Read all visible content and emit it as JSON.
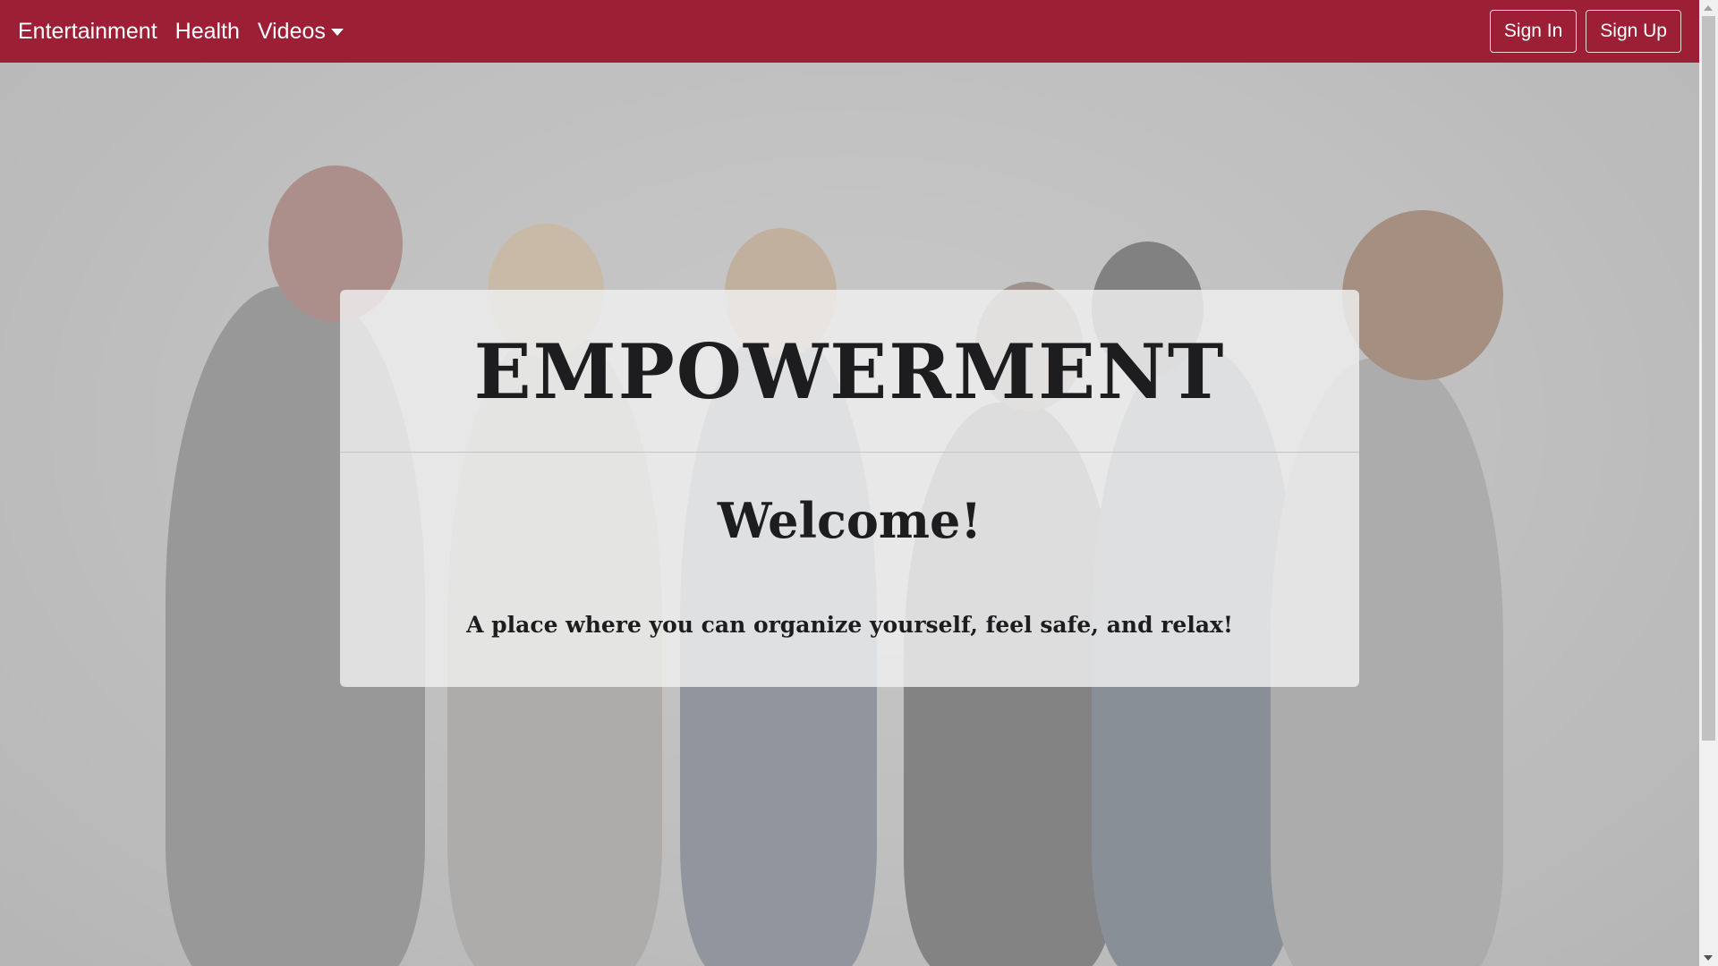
{
  "navbar": {
    "background": "#9d1f36",
    "links": [
      {
        "label": "Entertainment"
      },
      {
        "label": "Health"
      },
      {
        "label": "Videos",
        "icon": "chevron-down-icon"
      }
    ],
    "buttons": {
      "sign_in": "Sign In",
      "sign_up": "Sign Up"
    }
  },
  "hero": {
    "image": "group-of-women-photo",
    "card": {
      "brand": "EMPOWERMENT",
      "heading": "Welcome!",
      "tagline": "A place where you can organize yourself, feel safe, and relax!"
    }
  }
}
